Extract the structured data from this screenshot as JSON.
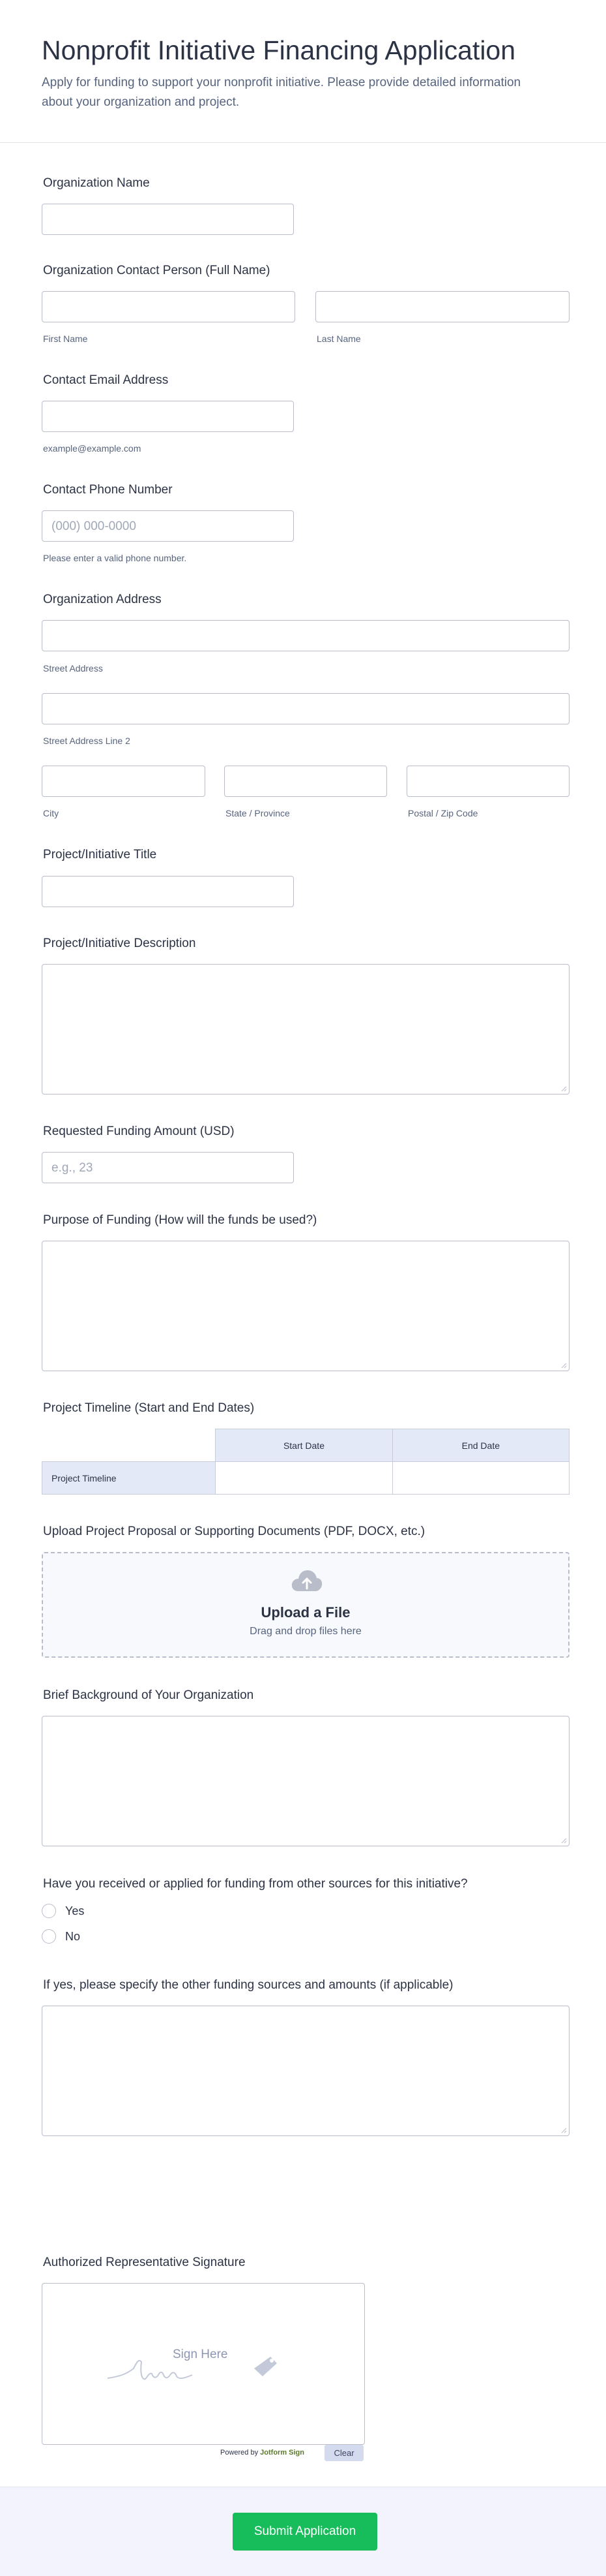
{
  "header": {
    "title": "Nonprofit Initiative Financing Application",
    "subtitle": "Apply for funding to support your nonprofit initiative. Please provide detailed information about your organization and project."
  },
  "org_name": {
    "label": "Organization Name"
  },
  "contact_person": {
    "label": "Organization Contact Person (Full Name)",
    "first_sub": "First Name",
    "last_sub": "Last Name"
  },
  "email": {
    "label": "Contact Email Address",
    "sub": "example@example.com"
  },
  "phone": {
    "label": "Contact Phone Number",
    "placeholder": "(000) 000-0000",
    "sub": "Please enter a valid phone number."
  },
  "address": {
    "label": "Organization Address",
    "street_sub": "Street Address",
    "street2_sub": "Street Address Line 2",
    "city_sub": "City",
    "state_sub": "State / Province",
    "zip_sub": "Postal / Zip Code"
  },
  "project_title": {
    "label": "Project/Initiative Title"
  },
  "project_desc": {
    "label": "Project/Initiative Description"
  },
  "funding_amount": {
    "label": "Requested Funding Amount (USD)",
    "placeholder": "e.g., 23"
  },
  "purpose": {
    "label": "Purpose of Funding (How will the funds be used?)"
  },
  "timeline": {
    "label": "Project Timeline (Start and End Dates)",
    "col_start": "Start Date",
    "col_end": "End Date",
    "row_label": "Project Timeline"
  },
  "upload": {
    "label": "Upload Project Proposal or Supporting Documents (PDF, DOCX, etc.)",
    "title": "Upload a File",
    "hint": "Drag and drop files here",
    "icon": "cloud-upload-icon"
  },
  "background": {
    "label": "Brief Background of Your Organization"
  },
  "other_funding": {
    "label": "Have you received or applied for funding from other sources for this initiative?",
    "options": [
      "Yes",
      "No"
    ]
  },
  "other_sources": {
    "label": "If yes, please specify the other funding sources and amounts (if applicable)"
  },
  "signature": {
    "label": "Authorized Representative Signature",
    "placeholder": "Sign Here",
    "powered_prefix": "Powered by",
    "powered_brand": "Jotform Sign",
    "clear": "Clear"
  },
  "submit": {
    "label": "Submit Application"
  },
  "colors": {
    "accent": "#18bd5b",
    "text": "#2c3345",
    "muted": "#57647e",
    "border": "#b8bdc9"
  }
}
